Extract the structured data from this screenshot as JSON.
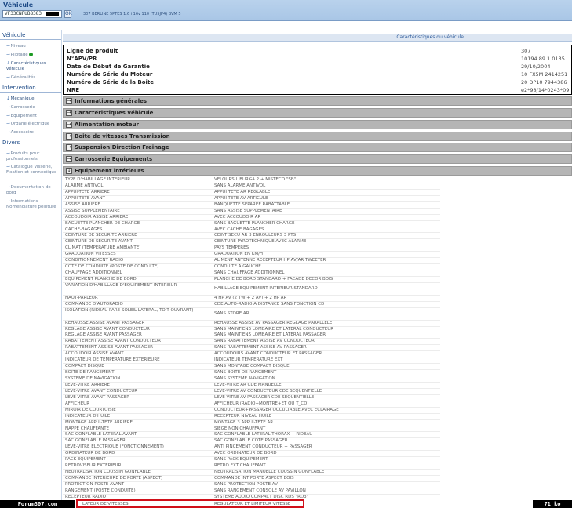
{
  "header": {
    "title": "Véhicule",
    "vin_value": "VF33CNFUB8383",
    "ok_label": "OK",
    "vehicle_description": "307 BERLINE 5PTES 1.6 i 16v 110 (TU5JP4) BVM 5"
  },
  "sidebar": {
    "sections": [
      {
        "title": "Véhicule",
        "items": [
          {
            "label": "Niveau"
          },
          {
            "label": "Pilotage"
          },
          {
            "label": "Caractéristiques véhicule"
          },
          {
            "label": "Généralités"
          }
        ]
      },
      {
        "title": "Intervention",
        "items": [
          {
            "label": "Mécanique"
          },
          {
            "label": "Carrosserie"
          },
          {
            "label": "Equipement"
          },
          {
            "label": "Organe électrique"
          },
          {
            "label": "Accessoire"
          }
        ]
      },
      {
        "title": "Divers",
        "items": [
          {
            "label": "Produits pour professionnels"
          },
          {
            "label": "Catalogue Visserie, Fixation et connectique"
          },
          {
            "label": "Documentation de bord"
          },
          {
            "label": "Informations Nomenclature peinture"
          }
        ]
      }
    ]
  },
  "main": {
    "title": "Caractéristiques du véhicule",
    "product_info": [
      {
        "label": "Ligne de produit",
        "value": "307"
      },
      {
        "label": "N°APV/PR",
        "value": "10194 89 1 0135"
      },
      {
        "label": "Date de Début de Garantie",
        "value": "29/10/2004"
      },
      {
        "label": "Numéro de Série du Moteur",
        "value": "10 FX5M 2414251"
      },
      {
        "label": "Numéro de Série de la Boite",
        "value": "20 DP10 7944386"
      },
      {
        "label": "NRE",
        "value": "e2*98/14*0243*09"
      }
    ],
    "sections": [
      {
        "label": "Informations générales",
        "expanded": false
      },
      {
        "label": "Caractéristiques véhicule",
        "expanded": false
      },
      {
        "label": "Alimentation moteur",
        "expanded": false
      },
      {
        "label": "Boite de vitesses Transmission",
        "expanded": false
      },
      {
        "label": "Suspension Direction Freinage",
        "expanded": false
      },
      {
        "label": "Carrosserie Equipements",
        "expanded": false
      },
      {
        "label": "Equipement intérieurs",
        "expanded": true
      }
    ],
    "equipment_rows": [
      [
        "TYPE D'HABILLAGE INTÉRIEUR",
        "VELOURS LIBURGA 2 + MISTECO \"SB\""
      ],
      [
        "ALARME ANTIVOL",
        "SANS ALARME ANTIVOL"
      ],
      [
        "APPUI-TÊTE ARRIÈRE",
        "APPUI TETE AR REGLABLE"
      ],
      [
        "APPUI-TÊTE AVANT",
        "APPUI-TETE AV ARTICULE"
      ],
      [
        "ASSISE ARRIÈRE",
        "BANQUETTE SEPAREE RABATTABLE"
      ],
      [
        "ASSISE SUPPLÉMENTAIRE",
        "SANS ASSISE SUPPLEMENTAIRE"
      ],
      [
        "ACCOUDOIR ASSISE ARRIÈRE",
        "AVEC ACCOUDOIR AR"
      ],
      [
        "BAGUETTE PLANCHER DE CHARGE",
        "SANS BAGUETTE PLANCHER CHARGE"
      ],
      [
        "CACHE-BAGAGES",
        "AVEC CACHE BAGAGES"
      ],
      [
        "CEINTURE DE SÉCURITÉ ARRIÈRE",
        "CEINT SECU AR 3 ENROULEURS 3 PTS"
      ],
      [
        "CEINTURE DE SÉCURITÉ AVANT",
        "CEINTURE PYROTECHNIQUE AVEC ALARME"
      ],
      [
        "CLIMAT (TEMPÉRATURE AMBIANTE)",
        "PAYS TEMPERES"
      ],
      [
        "GRADUATION VITESSES",
        "GRADUATION EN KM/H"
      ],
      [
        "CONDITIONNEMENT RADIO",
        "ALIMENT ANTENNE RECEPTEUR HP AV/AR TWEETER"
      ],
      [
        "CÔTÉ DE CONDUITE (POSTE DE CONDUITE)",
        "CONDUITE A GAUCHE"
      ],
      [
        "CHAUFFAGE ADDITIONNEL",
        "SANS CHAUFFAGE ADDITIONNEL"
      ],
      [
        "EQUIPEMENT PLANCHE DE BORD",
        "PLANCHE DE BORD STANDARD + FACADE DECOR BOIS"
      ],
      [
        "VARIATION D'HABILLAGE D'ÉQUIPEMENT INTÉRIEUR",
        "HABILLAGE EQUIPEMENT INTERIEUR STANDARD"
      ],
      [
        "HAUT-PARLEUR",
        "4 HP AV (2 TW + 2 AV) + 2 HP AR"
      ],
      [
        "COMMANDE D'AUTORADIO",
        "CDE AUTO-RADIO A DISTANCE SANS FONCTION CD"
      ],
      [
        "ISOLATION (RIDEAU PARE-SOLEIL LATÉRAL, TOIT OUVRANT)",
        "SANS STORE AR"
      ],
      [
        "REHAUSSE ASSISE AVANT PASSAGER",
        "REHAUSSE ASSISE AV PASSAGER REGLAGE PARALLELE"
      ],
      [
        "RÉGLAGE ASSISE AVANT CONDUCTEUR",
        "SANS MAINTIENS LOMBAIRE ET LATERAL CONDUCTEUR"
      ],
      [
        "RÉGLAGE ASSISE AVANT PASSAGER",
        "SANS MAINTIENS LOMBAIRE ET LATERAL PASSAGER"
      ],
      [
        "RABATTEMENT ASSISE AVANT CONDUCTEUR",
        "SANS RABATTEMENT ASSISE AV CONDUCTEUR"
      ],
      [
        "RABATTEMENT ASSISE AVANT PASSAGER",
        "SANS RABATTEMENT ASSISE AV PASSAGER"
      ],
      [
        "ACCOUDOIR ASSISE AVANT",
        "ACCOUDOIRS AVANT CONDUCTEUR ET PASSAGER"
      ],
      [
        "INDICATEUR DE TEMPÉRATURE EXTÉRIEURE",
        "INDICATEUR TEMPERATURE EXT"
      ],
      [
        "COMPACT DISQUE",
        "SANS MONTAGE COMPACT DISQUE"
      ],
      [
        "BOITE DE RANGEMENT",
        "SANS BOITE DE RANGEMENT"
      ],
      [
        "SYSTÈME DE NAVIGATION",
        "SANS SYSTEME NAVIGATION"
      ],
      [
        "LÈVE-VITRE ARRIÈRE",
        "LEVE-VITRE AR CDE MANUELLE"
      ],
      [
        "LÈVE-VITRE AVANT CONDUCTEUR",
        "LEVE-VITRE AV CONDUCTEUR CDE SEQUENTIELLE"
      ],
      [
        "LÈVE-VITRE AVANT PASSAGER",
        "LEVE-VITRE AV PASSAGER CDE SEQUENTIELLE"
      ],
      [
        "AFFICHEUR",
        "AFFICHEUR (RADIO+MONTRE+ET OU T_CD)"
      ],
      [
        "MIROIR DE COURTOISIE",
        "CONDUCTEUR+PASSAGER OCCULTABLE AVEC ECLAIRAGE"
      ],
      [
        "INDICATEUR D'HUILE",
        "RECEPTEUR NIVEAU HUILE"
      ],
      [
        "MONTAGE APPUI-TÊTE ARRIÈRE",
        "MONTAGE 3 APPUI-TETE AR"
      ],
      [
        "NAPPE CHAUFFANTE",
        "SIEGE NON CHAUFFANT"
      ],
      [
        "SAC GONFLABLE LATÉRAL AVANT",
        "SAC GONFLABLE LATERAL THORAX + RIDEAU"
      ],
      [
        "SAC GONFLABLE PASSAGER",
        "SAC GONFLABLE COTE PASSAGER"
      ],
      [
        "LÈVE-VITRE ÉLECTRIQUE (FONCTIONNEMENT)",
        "ANTI PINCEMENT CONDUCTEUR + PASSAGER"
      ],
      [
        "ORDINATEUR DE BORD",
        "AVEC ORDINATEUR DE BORD"
      ],
      [
        "PACK ÉQUIPEMENT",
        "SANS PACK EQUIPEMENT"
      ],
      [
        "RÉTROVISEUR EXTÉRIEUR",
        "RETRO EXT CHAUFFANT"
      ],
      [
        "NEUTRALISATION COUSSIN GONFLABLE",
        "NEUTRALISATION MANUELLE COUSSIN GONFLABLE"
      ],
      [
        "COMMANDE INTÉRIEURE DE PORTE (ASPECT)",
        "COMMANDE INT PORTE ASPECT BOIS"
      ],
      [
        "PROTECTION POSTE AVANT",
        "SANS PROTECTION POSTE AV"
      ],
      [
        "RANGEMENT (POSTE CONDUITE)",
        "SANS RANGEMENT CONSOLE AV PAVILLON"
      ],
      [
        "RÉCEPTEUR RADIO",
        "SYSTEME AUDIO COMPACT DISC RDS \"RD3\""
      ],
      [
        "RÉFRIGÉRATION",
        "REFRIGERATION AUTOMATIQUE"
      ]
    ],
    "last_row": [
      "LATEUR DE VITESSES",
      "REGULATEUR ET LIMITEUR VITESSE"
    ]
  },
  "footer": {
    "forum": "Forum307.com",
    "size": "71 ko"
  }
}
